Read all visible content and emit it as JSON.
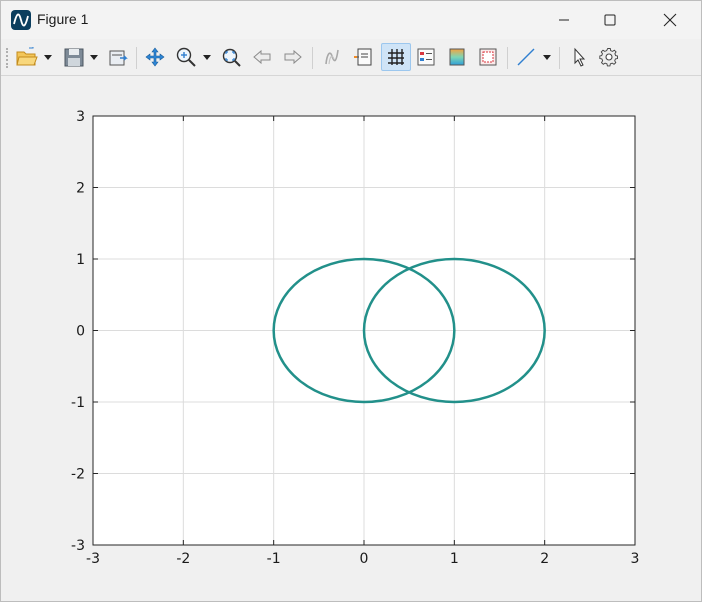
{
  "window": {
    "title": "Figure 1",
    "controls": {
      "minimize": "minimize",
      "maximize": "maximize",
      "close": "close"
    }
  },
  "toolbar": {
    "items": [
      {
        "name": "open-file",
        "icon": "folder-open-icon",
        "has_dropdown": true
      },
      {
        "name": "save",
        "icon": "floppy-save-icon",
        "has_dropdown": true
      },
      {
        "name": "print",
        "icon": "print-icon",
        "has_dropdown": false
      },
      {
        "name": "pan",
        "icon": "pan-arrows-icon",
        "has_dropdown": false
      },
      {
        "name": "zoom",
        "icon": "zoom-in-icon",
        "has_dropdown": true
      },
      {
        "name": "autoscale",
        "icon": "autoscale-icon",
        "has_dropdown": false
      },
      {
        "name": "back",
        "icon": "arrow-left-icon",
        "has_dropdown": false
      },
      {
        "name": "forward",
        "icon": "arrow-right-icon",
        "has_dropdown": false
      },
      {
        "name": "rotate",
        "icon": "rotate-3d-icon",
        "has_dropdown": false
      },
      {
        "name": "text-annotation",
        "icon": "text-box-icon",
        "has_dropdown": false
      },
      {
        "name": "grid",
        "icon": "grid-icon",
        "has_dropdown": false,
        "active": true
      },
      {
        "name": "legend",
        "icon": "legend-icon",
        "has_dropdown": false
      },
      {
        "name": "colorbar",
        "icon": "colorbar-icon",
        "has_dropdown": false
      },
      {
        "name": "axes-box",
        "icon": "axes-box-icon",
        "has_dropdown": false
      },
      {
        "name": "line-tool",
        "icon": "line-draw-icon",
        "has_dropdown": true
      },
      {
        "name": "select",
        "icon": "pointer-icon",
        "has_dropdown": false
      },
      {
        "name": "settings",
        "icon": "gear-icon",
        "has_dropdown": false
      }
    ]
  },
  "chart_data": {
    "type": "line",
    "title": "",
    "xlabel": "",
    "ylabel": "",
    "xlim": [
      -3,
      3
    ],
    "ylim": [
      -3,
      3
    ],
    "xticks": [
      -3,
      -2,
      -1,
      0,
      1,
      2,
      3
    ],
    "yticks": [
      -3,
      -2,
      -1,
      0,
      1,
      2,
      3
    ],
    "grid": true,
    "line_color": "#22908a",
    "series": [
      {
        "shape": "circle",
        "center": [
          0,
          0
        ],
        "radius": 1
      },
      {
        "shape": "circle",
        "center": [
          1,
          0
        ],
        "radius": 1
      }
    ]
  }
}
